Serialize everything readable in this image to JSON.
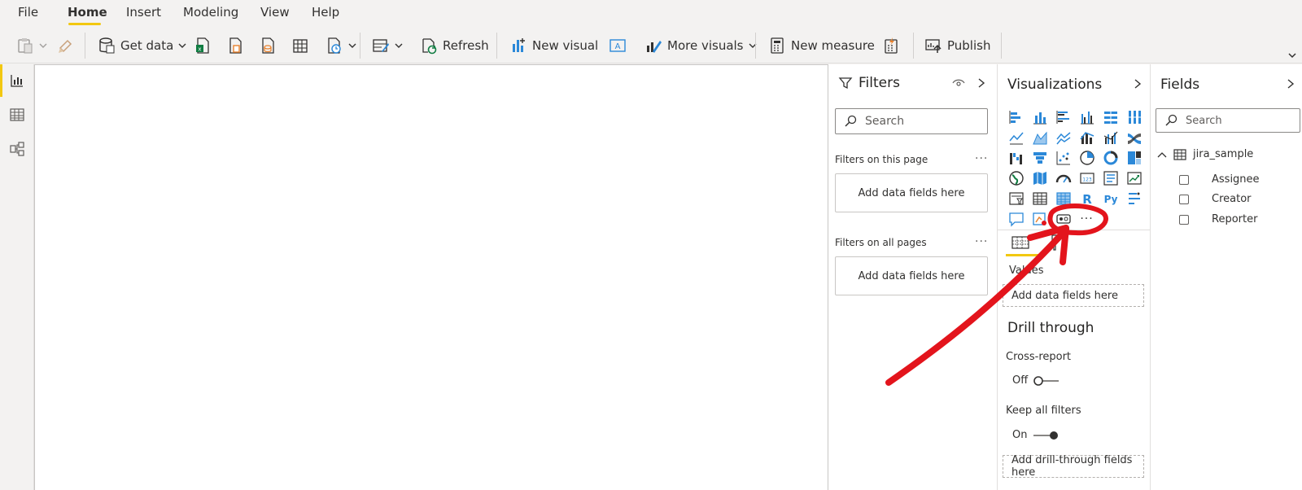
{
  "menu": {
    "file": "File",
    "home": "Home",
    "insert": "Insert",
    "modeling": "Modeling",
    "view": "View",
    "help": "Help"
  },
  "ribbon": {
    "get_data": "Get data",
    "refresh": "Refresh",
    "new_visual": "New visual",
    "more_visuals": "More visuals",
    "new_measure": "New measure",
    "publish": "Publish"
  },
  "filters": {
    "title": "Filters",
    "search_placeholder": "Search",
    "on_this_page": "Filters on this page",
    "on_all_pages": "Filters on all pages",
    "add_fields": "Add data fields here",
    "more": "···"
  },
  "visualizations": {
    "title": "Visualizations",
    "more_visuals_icon": "···",
    "values_label": "Values",
    "add_fields": "Add data fields here",
    "drill_through": "Drill through",
    "cross_report": "Cross-report",
    "cross_report_state": "Off",
    "keep_all_filters": "Keep all filters",
    "keep_all_filters_state": "On",
    "add_drill_fields": "Add drill-through fields here",
    "r_label": "R",
    "py_label": "Py"
  },
  "fields": {
    "title": "Fields",
    "search_placeholder": "Search",
    "table_name": "jira_sample",
    "columns": [
      "Assignee",
      "Creator",
      "Reporter"
    ]
  },
  "colors": {
    "accent_yellow": "#f2c811",
    "icon_blue": "#2b88d8",
    "annotation_red": "#e3141c"
  }
}
